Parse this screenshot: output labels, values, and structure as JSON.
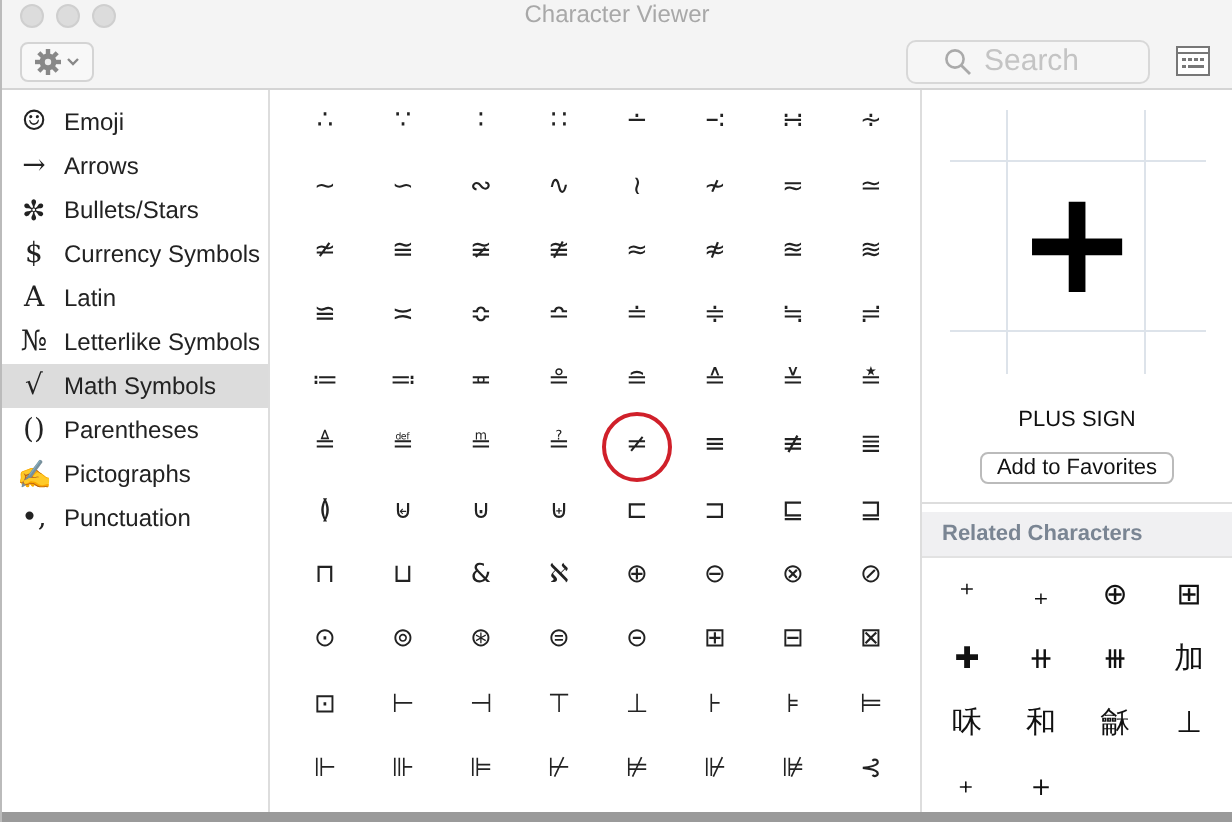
{
  "window": {
    "title": "Character Viewer"
  },
  "toolbar": {
    "search": {
      "placeholder": "Search"
    }
  },
  "sidebar": {
    "items": [
      {
        "icon": "☺",
        "label": "Emoji",
        "selected": false
      },
      {
        "icon": "→",
        "label": "Arrows",
        "selected": false
      },
      {
        "icon": "✼",
        "label": "Bullets/Stars",
        "selected": false
      },
      {
        "icon": "$",
        "label": "Currency Symbols",
        "selected": false
      },
      {
        "icon": "A",
        "label": "Latin",
        "selected": false
      },
      {
        "icon": "№",
        "label": "Letterlike Symbols",
        "selected": false
      },
      {
        "icon": "√",
        "label": "Math Symbols",
        "selected": true
      },
      {
        "icon": "()",
        "label": "Parentheses",
        "selected": false
      },
      {
        "icon": "✍",
        "label": "Pictographs",
        "selected": false
      },
      {
        "icon": "•,",
        "label": "Punctuation",
        "selected": false
      }
    ]
  },
  "grid": {
    "rows": [
      [
        {
          "char": "∴",
          "circled": false
        },
        {
          "char": "∵",
          "circled": false
        },
        {
          "char": "∶",
          "circled": false
        },
        {
          "char": "∷",
          "circled": false
        },
        {
          "char": "∸",
          "circled": false
        },
        {
          "char": "∹",
          "circled": false
        },
        {
          "char": "∺",
          "circled": false
        },
        {
          "char": "∻",
          "circled": false
        }
      ],
      [
        {
          "char": "∼",
          "circled": false
        },
        {
          "char": "∽",
          "circled": false
        },
        {
          "char": "∾",
          "circled": false
        },
        {
          "char": "∿",
          "circled": false
        },
        {
          "char": "≀",
          "circled": false
        },
        {
          "char": "≁",
          "circled": false
        },
        {
          "char": "≂",
          "circled": false
        },
        {
          "char": "≃",
          "circled": false
        }
      ],
      [
        {
          "char": "≄",
          "circled": false
        },
        {
          "char": "≅",
          "circled": false
        },
        {
          "char": "≆",
          "circled": false
        },
        {
          "char": "≇",
          "circled": false
        },
        {
          "char": "≈",
          "circled": false
        },
        {
          "char": "≉",
          "circled": false
        },
        {
          "char": "≊",
          "circled": false
        },
        {
          "char": "≋",
          "circled": false
        }
      ],
      [
        {
          "char": "≌",
          "circled": false
        },
        {
          "char": "≍",
          "circled": false
        },
        {
          "char": "≎",
          "circled": false
        },
        {
          "char": "≏",
          "circled": false
        },
        {
          "char": "≐",
          "circled": false
        },
        {
          "char": "≑",
          "circled": false
        },
        {
          "char": "≒",
          "circled": false
        },
        {
          "char": "≓",
          "circled": false
        }
      ],
      [
        {
          "char": "≔",
          "circled": false
        },
        {
          "char": "≕",
          "circled": false
        },
        {
          "char": "≖",
          "circled": false
        },
        {
          "char": "≗",
          "circled": false
        },
        {
          "char": "≘",
          "circled": false
        },
        {
          "char": "≙",
          "circled": false
        },
        {
          "char": "≚",
          "circled": false
        },
        {
          "char": "≛",
          "circled": false
        }
      ],
      [
        {
          "char": "≜",
          "circled": false
        },
        {
          "char": "≝",
          "circled": false
        },
        {
          "char": "≞",
          "circled": false
        },
        {
          "char": "≟",
          "circled": false
        },
        {
          "char": "≠",
          "circled": true
        },
        {
          "char": "≡",
          "circled": false
        },
        {
          "char": "≢",
          "circled": false
        },
        {
          "char": "≣",
          "circled": false
        }
      ],
      [
        {
          "char": "≬",
          "circled": false
        },
        {
          "char": "⊌",
          "circled": false
        },
        {
          "char": "⊍",
          "circled": false
        },
        {
          "char": "⊎",
          "circled": false
        },
        {
          "char": "⊏",
          "circled": false
        },
        {
          "char": "⊐",
          "circled": false
        },
        {
          "char": "⊑",
          "circled": false
        },
        {
          "char": "⊒",
          "circled": false
        }
      ],
      [
        {
          "char": "⊓",
          "circled": false
        },
        {
          "char": "⊔",
          "circled": false
        },
        {
          "char": "&",
          "circled": false
        },
        {
          "char": "ℵ",
          "circled": false
        },
        {
          "char": "⊕",
          "circled": false
        },
        {
          "char": "⊖",
          "circled": false
        },
        {
          "char": "⊗",
          "circled": false
        },
        {
          "char": "⊘",
          "circled": false
        }
      ],
      [
        {
          "char": "⊙",
          "circled": false
        },
        {
          "char": "⊚",
          "circled": false
        },
        {
          "char": "⊛",
          "circled": false
        },
        {
          "char": "⊜",
          "circled": false
        },
        {
          "char": "⊝",
          "circled": false
        },
        {
          "char": "⊞",
          "circled": false
        },
        {
          "char": "⊟",
          "circled": false
        },
        {
          "char": "⊠",
          "circled": false
        }
      ],
      [
        {
          "char": "⊡",
          "circled": false
        },
        {
          "char": "⊢",
          "circled": false
        },
        {
          "char": "⊣",
          "circled": false
        },
        {
          "char": "⊤",
          "circled": false
        },
        {
          "char": "⊥",
          "circled": false
        },
        {
          "char": "⊦",
          "circled": false
        },
        {
          "char": "⊧",
          "circled": false
        },
        {
          "char": "⊨",
          "circled": false
        }
      ],
      [
        {
          "char": "⊩",
          "circled": false
        },
        {
          "char": "⊪",
          "circled": false
        },
        {
          "char": "⊫",
          "circled": false
        },
        {
          "char": "⊬",
          "circled": false
        },
        {
          "char": "⊭",
          "circled": false
        },
        {
          "char": "⊮",
          "circled": false
        },
        {
          "char": "⊯",
          "circled": false
        },
        {
          "char": "⊰",
          "circled": false
        }
      ]
    ]
  },
  "detail": {
    "char": "+",
    "name": "PLUS SIGN",
    "button": "Add to Favorites"
  },
  "related": {
    "title": "Related Characters",
    "characters": [
      "⁺",
      "₊",
      "⊕",
      "⊞",
      "✚",
      "⧺",
      "⧻",
      "加",
      "咊",
      "和",
      "龢",
      "⊥",
      "﹢",
      "＋"
    ]
  }
}
